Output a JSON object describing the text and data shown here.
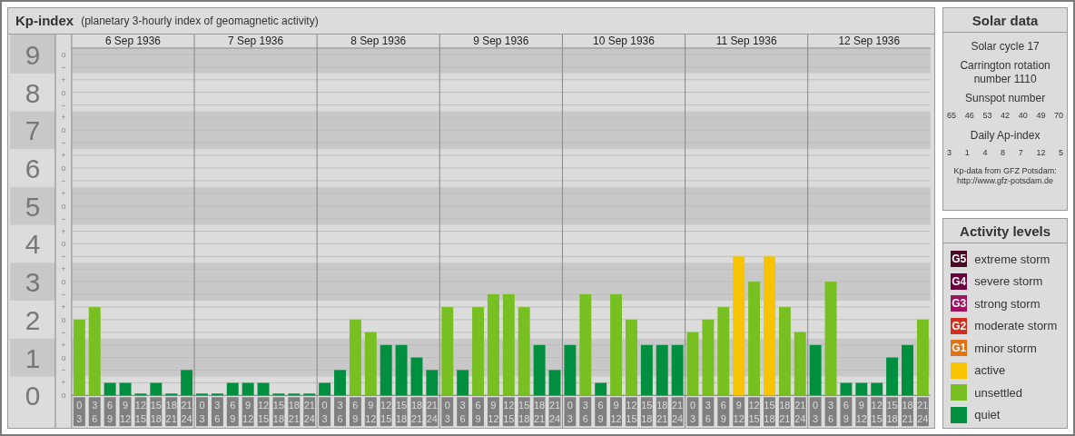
{
  "kp_panel": {
    "title": "Kp-index",
    "subtitle": "(planetary 3-hourly index of geomagnetic activity)",
    "days": [
      "6 Sep 1936",
      "7 Sep 1936",
      "8 Sep 1936",
      "9 Sep 1936",
      "10 Sep 1936",
      "11 Sep 1936",
      "12 Sep 1936"
    ],
    "minor_tick_labels": [
      "o",
      "−",
      "+",
      "o",
      "−",
      "+",
      "o",
      "−",
      "+",
      "o",
      "−",
      "+",
      "o",
      "−",
      "+",
      "o",
      "−",
      "+",
      "o",
      "−",
      "+",
      "o",
      "−",
      "+",
      "o",
      "−",
      "+",
      "o"
    ],
    "chart_data": {
      "type": "bar",
      "grid": true,
      "ylim": [
        0,
        9
      ],
      "yticks": [
        0,
        1,
        2,
        3,
        4,
        5,
        6,
        7,
        8,
        9
      ],
      "categories": [
        "0 3",
        "3 6",
        "6 9",
        "9 12",
        "12 15",
        "15 18",
        "18 21",
        "21 24",
        "0 3",
        "3 6",
        "6 9",
        "9 12",
        "12 15",
        "15 18",
        "18 21",
        "21 24",
        "0 3",
        "3 6",
        "6 9",
        "9 12",
        "12 15",
        "15 18",
        "18 21",
        "21 24",
        "0 3",
        "3 6",
        "6 9",
        "9 12",
        "12 15",
        "15 18",
        "18 21",
        "21 24",
        "0 3",
        "3 6",
        "6 9",
        "9 12",
        "12 15",
        "15 18",
        "18 21",
        "21 24",
        "0 3",
        "3 6",
        "6 9",
        "9 12",
        "12 15",
        "15 18",
        "18 21",
        "21 24",
        "0 3",
        "3 6",
        "6 9",
        "9 12",
        "12 15",
        "15 18",
        "18 21",
        "21 24"
      ],
      "series": [
        {
          "name": "quiet",
          "color": "#008f3e",
          "values": [
            null,
            null,
            0.33,
            0.33,
            0,
            0.33,
            0,
            0.67,
            0,
            0,
            0.33,
            0.33,
            0.33,
            0,
            0,
            0,
            0.33,
            0.67,
            null,
            null,
            1.33,
            1.33,
            1,
            0.67,
            null,
            0.67,
            null,
            null,
            null,
            null,
            1.33,
            0.67,
            1.33,
            null,
            0.33,
            null,
            null,
            1.33,
            1.33,
            1.33,
            null,
            null,
            null,
            null,
            null,
            null,
            null,
            null,
            1.33,
            null,
            0.33,
            0.33,
            0.33,
            1,
            1.33,
            null
          ]
        },
        {
          "name": "unsettled",
          "color": "#78bf21",
          "values": [
            2,
            2.33,
            null,
            null,
            null,
            null,
            null,
            null,
            null,
            null,
            null,
            null,
            null,
            null,
            null,
            null,
            null,
            null,
            2,
            1.67,
            null,
            null,
            null,
            null,
            2.33,
            null,
            2.33,
            2.67,
            2.67,
            2.33,
            null,
            null,
            null,
            2.67,
            null,
            2.67,
            2,
            null,
            null,
            null,
            1.67,
            2,
            2.33,
            null,
            3,
            null,
            2.33,
            1.67,
            null,
            3,
            null,
            null,
            null,
            null,
            null,
            2
          ]
        },
        {
          "name": "active",
          "color": "#f8c300",
          "values": [
            null,
            null,
            null,
            null,
            null,
            null,
            null,
            null,
            null,
            null,
            null,
            null,
            null,
            null,
            null,
            null,
            null,
            null,
            null,
            null,
            null,
            null,
            null,
            null,
            null,
            null,
            null,
            null,
            null,
            null,
            null,
            null,
            null,
            null,
            null,
            null,
            null,
            null,
            null,
            null,
            null,
            null,
            null,
            3.67,
            null,
            3.67,
            null,
            null,
            null,
            null,
            null,
            null,
            null,
            null,
            null,
            null
          ]
        }
      ]
    }
  },
  "solar_data": {
    "title": "Solar data",
    "solar_cycle": "Solar cycle 17",
    "carrington": "Carrington rotation number 1110",
    "sunspot_title": "Sunspot number",
    "sunspot_numbers": [
      "65",
      "46",
      "53",
      "42",
      "40",
      "49",
      "70"
    ],
    "ap_title": "Daily Ap-index",
    "ap_values": [
      "3",
      "1",
      "4",
      "8",
      "7",
      "12",
      "5"
    ],
    "source": "Kp-data from GFZ Potsdam:",
    "source_url": "http://www.gfz-potsdam.de"
  },
  "activity_levels": {
    "title": "Activity levels",
    "items": [
      {
        "badge": "G5",
        "label": "extreme storm",
        "color": "#4b0a26"
      },
      {
        "badge": "G4",
        "label": "severe storm",
        "color": "#6a003f"
      },
      {
        "badge": "G3",
        "label": "strong storm",
        "color": "#a0105c"
      },
      {
        "badge": "G2",
        "label": "moderate storm",
        "color": "#d42e1c"
      },
      {
        "badge": "G1",
        "label": "minor storm",
        "color": "#e27211"
      }
    ]
  }
}
